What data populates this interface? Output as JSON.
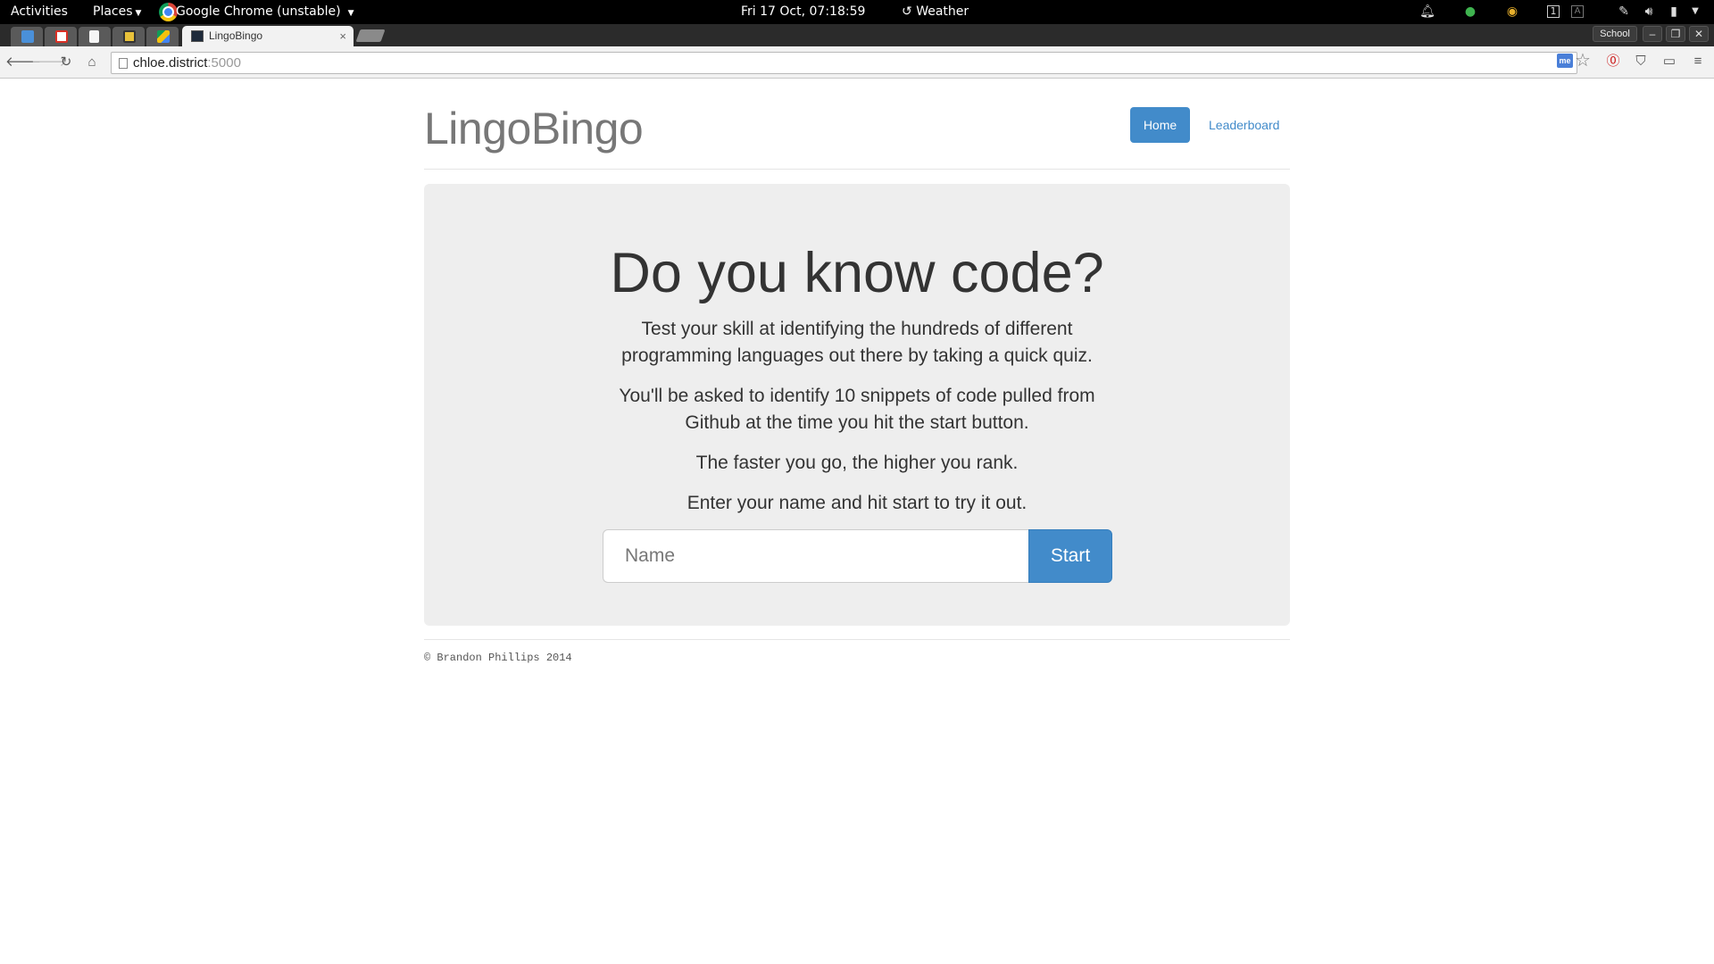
{
  "topbar": {
    "activities": "Activities",
    "places": "Places",
    "app_name": "Google Chrome (unstable)",
    "clock": "Fri 17 Oct, 07:18:59",
    "weather": "Weather"
  },
  "tabs": {
    "active_title": "LingoBingo",
    "close_glyph": "×",
    "profile": "School"
  },
  "address": {
    "host": "chloe.district",
    "port": ":5000"
  },
  "site": {
    "brand": "LingoBingo",
    "nav": {
      "home": "Home",
      "leaderboard": "Leaderboard"
    },
    "hero": {
      "title": "Do you know code?",
      "p1": "Test your skill at identifying the hundreds of different programming languages out there by taking a quick quiz.",
      "p2": "You'll be asked to identify 10 snippets of code pulled from Github at the time you hit the start button.",
      "p3": "The faster you go, the higher you rank.",
      "p4": "Enter your name and hit start to try it out."
    },
    "form": {
      "name_placeholder": "Name",
      "start_label": "Start"
    },
    "footer": "© Brandon Phillips 2014"
  },
  "colors": {
    "primary": "#428bca",
    "jumbotron_bg": "#eeeeee",
    "brand_text": "#777777"
  },
  "icons": [
    "back-icon",
    "forward-icon",
    "reload-icon",
    "home-icon",
    "star-icon",
    "menu-icon",
    "bell-icon",
    "volume-icon",
    "battery-icon"
  ]
}
